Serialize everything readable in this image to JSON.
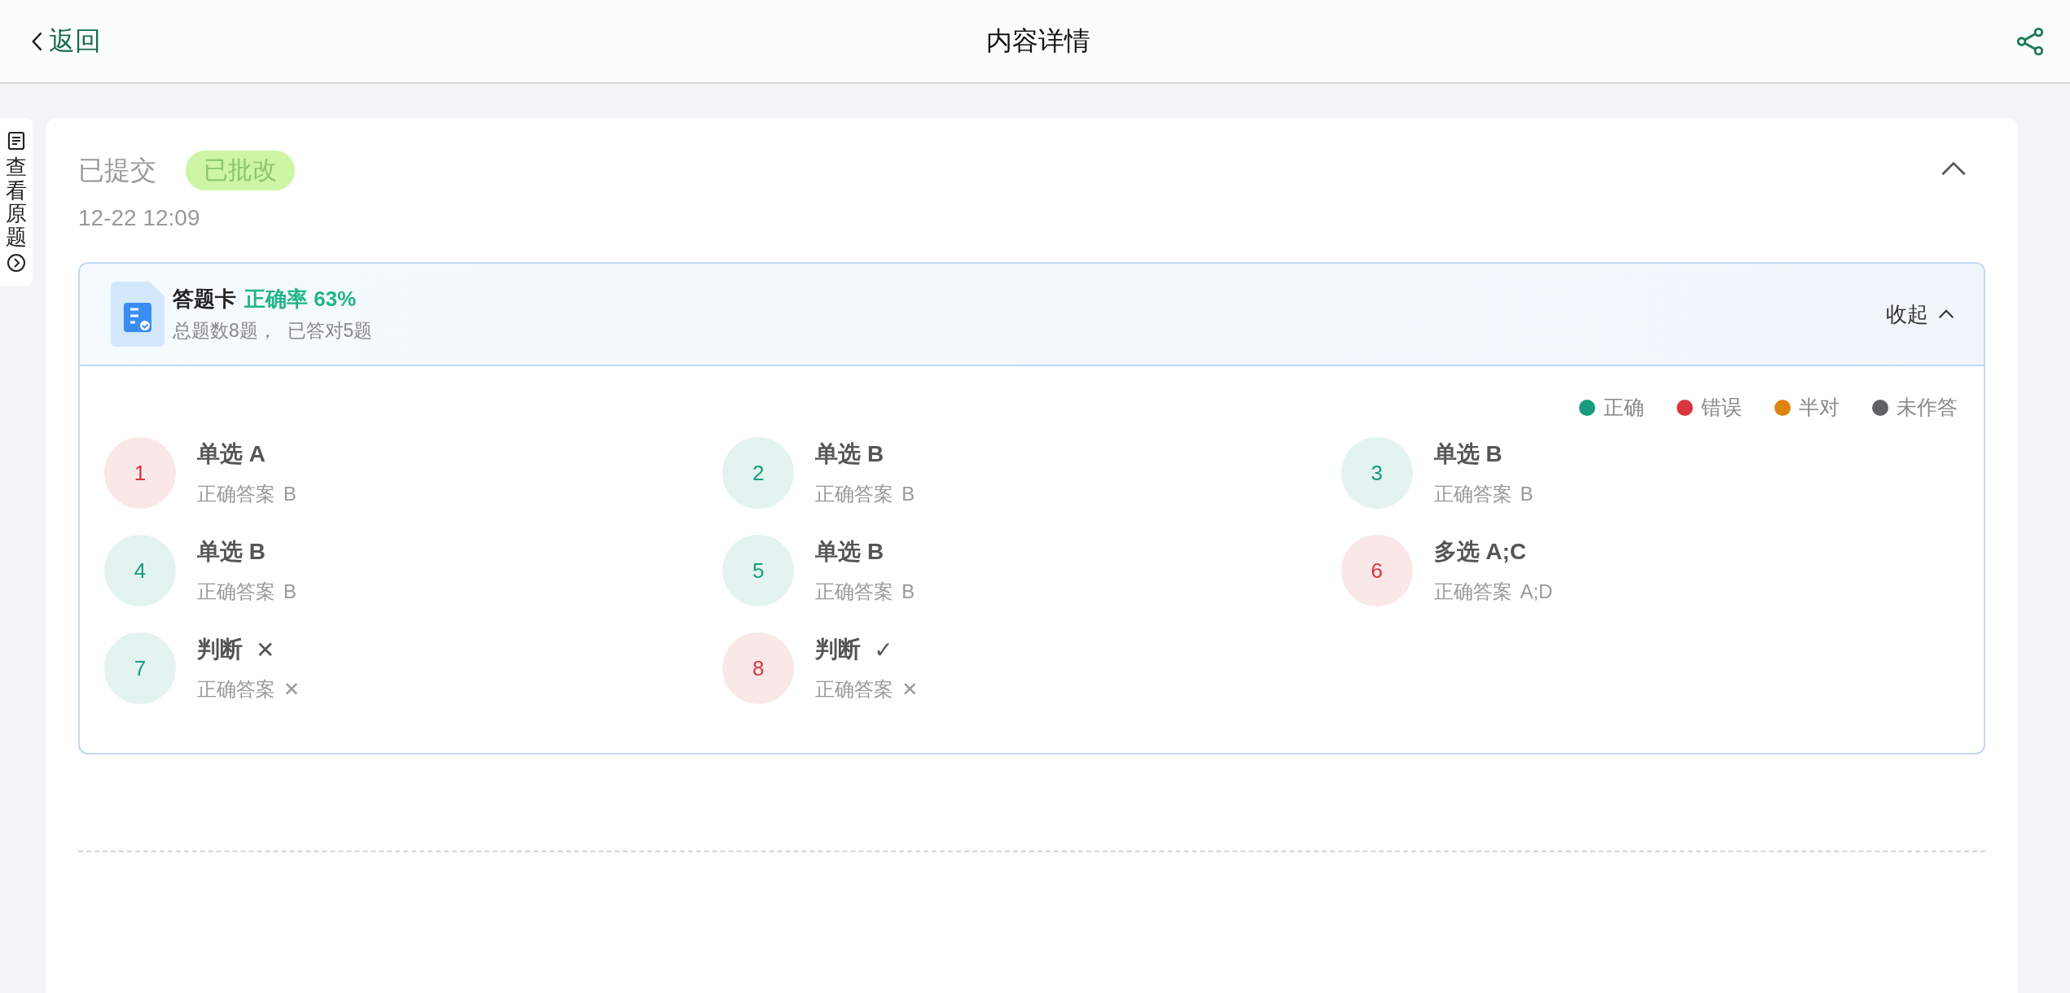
{
  "nav": {
    "back": "返回",
    "title": "内容详情"
  },
  "side_tab": {
    "label": "查看原题"
  },
  "submission": {
    "status": "已提交",
    "badge": "已批改",
    "time": "12-22 12:09",
    "expanded": true
  },
  "answer_card": {
    "title": "答题卡",
    "accuracy": "正确率 63%",
    "summary": "总题数8题，  已答对5题",
    "collapse": "收起",
    "legend": [
      {
        "label": "正确",
        "color": "#189b7f"
      },
      {
        "label": "错误",
        "color": "#d9363e"
      },
      {
        "label": "半对",
        "color": "#dd850e"
      },
      {
        "label": "未作答",
        "color": "#606066"
      }
    ],
    "questions": [
      {
        "number": "1",
        "color": "#d9363e",
        "answer": "单选 A",
        "correct_label": "正确答案",
        "correct_answer": "B"
      },
      {
        "number": "2",
        "color": "#189b7f",
        "answer": "单选 B",
        "correct_label": "正确答案",
        "correct_answer": "B"
      },
      {
        "number": "3",
        "color": "#189b7f",
        "answer": "单选 B",
        "correct_label": "正确答案",
        "correct_answer": "B"
      },
      {
        "number": "4",
        "color": "#189b7f",
        "answer": "单选 B",
        "correct_label": "正确答案",
        "correct_answer": "B"
      },
      {
        "number": "5",
        "color": "#189b7f",
        "answer": "单选 B",
        "correct_label": "正确答案",
        "correct_answer": "B"
      },
      {
        "number": "6",
        "color": "#d9363e",
        "answer": "多选 A;C",
        "correct_label": "正确答案",
        "correct_answer": "A;D"
      },
      {
        "number": "7",
        "color": "#189b7f",
        "answer": "判断",
        "answer_mark": "✕",
        "correct_label": "正确答案",
        "correct_answer": "✕"
      },
      {
        "number": "8",
        "color": "#d9363e",
        "answer": "判断",
        "answer_mark": "✓",
        "correct_label": "正确答案",
        "correct_answer": "✕"
      }
    ]
  }
}
